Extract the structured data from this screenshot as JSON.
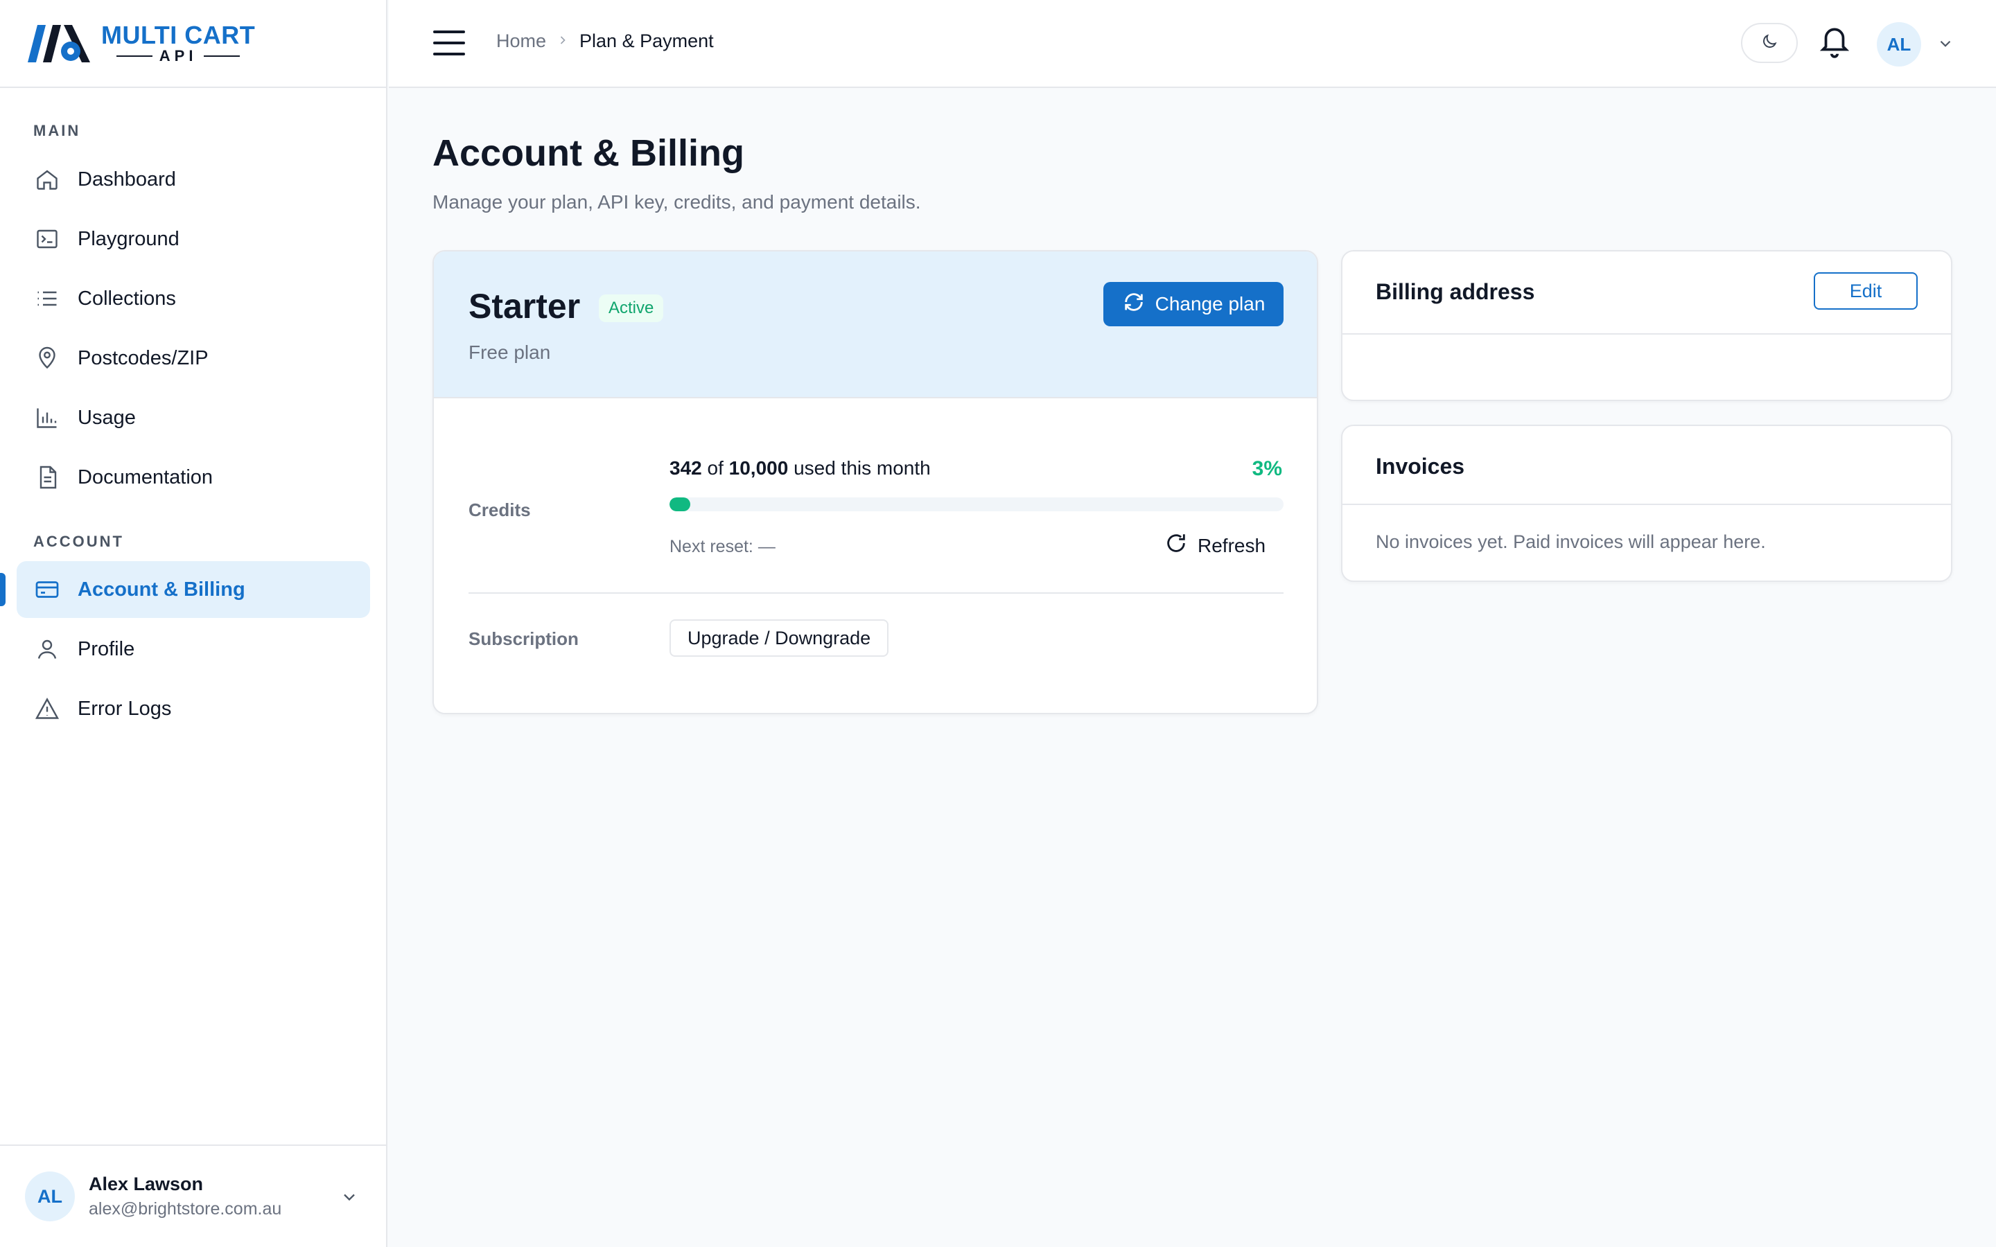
{
  "app": {
    "logo_title": "MULTI CART",
    "logo_sub": "API",
    "brand_color": "#1570c9"
  },
  "sidebar": {
    "section_main": "MAIN",
    "section_account": "ACCOUNT",
    "items": [
      {
        "label": "Dashboard",
        "icon": "home-icon"
      },
      {
        "label": "Playground",
        "icon": "terminal-icon"
      },
      {
        "label": "Collections",
        "icon": "list-icon"
      },
      {
        "label": "Postcodes/ZIP",
        "icon": "map-pin-icon"
      },
      {
        "label": "Usage",
        "icon": "bar-chart-icon"
      },
      {
        "label": "Documentation",
        "icon": "document-icon"
      },
      {
        "label": "Account & Billing",
        "icon": "credit-card-icon",
        "active": true
      },
      {
        "label": "Profile",
        "icon": "user-icon"
      },
      {
        "label": "Error Logs",
        "icon": "warning-icon"
      }
    ]
  },
  "user": {
    "initials": "AL",
    "name": "Alex Lawson",
    "email": "alex@brightstore.com.au"
  },
  "topbar": {
    "crumb_home": "Home",
    "crumb_current": "Plan & Payment",
    "avatar_initials": "AL"
  },
  "page": {
    "title": "Account & Billing",
    "subtitle": "Manage your plan, API key, credits, and payment details."
  },
  "plan": {
    "name": "Starter",
    "status": "Active",
    "description": "Free plan",
    "change_label": "Change plan",
    "credits_label": "Credits",
    "used": "342",
    "of_word": "of",
    "total": "10,000",
    "period_text": "used this month",
    "percent_text": "3%",
    "percent_value": 0.034,
    "next_reset": "Next reset: —",
    "refresh_label": "Refresh",
    "subscription_label": "Subscription",
    "upgrade_label": "Upgrade / Downgrade",
    "progress_color": "#10b981"
  },
  "billing": {
    "title": "Billing address",
    "edit_label": "Edit"
  },
  "invoices": {
    "title": "Invoices",
    "empty": "No invoices yet. Paid invoices will appear here."
  }
}
